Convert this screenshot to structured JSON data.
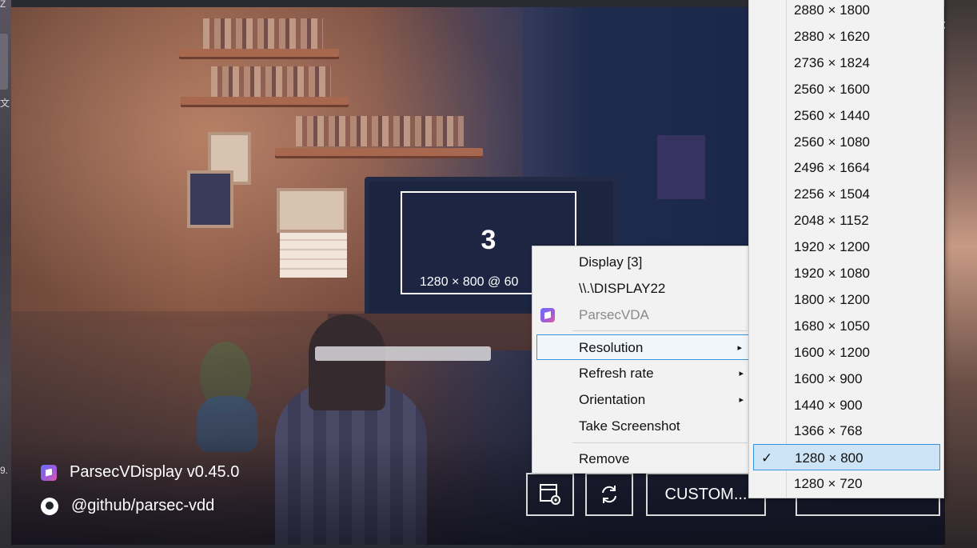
{
  "app": {
    "brand": "ParsecVDisplay v0.45.0",
    "github": "@github/parsec-vdd",
    "close_glyph": "×"
  },
  "display": {
    "number": "3",
    "resolution_label": "1280 × 800 @ 60"
  },
  "buttons": {
    "custom_label": "CUSTOM...",
    "settings_icon": "window-settings-icon",
    "refresh_icon": "refresh-icon"
  },
  "context_menu": {
    "display_label": "Display [3]",
    "device_path": "\\\\.\\DISPLAY22",
    "adapter": "ParsecVDA",
    "resolution": "Resolution",
    "refresh_rate": "Refresh rate",
    "orientation": "Orientation",
    "screenshot": "Take Screenshot",
    "remove": "Remove",
    "submenu_arrow": "▸"
  },
  "resolutions": [
    "2880 × 1800",
    "2880 × 1620",
    "2736 × 1824",
    "2560 × 1600",
    "2560 × 1440",
    "2560 × 1080",
    "2496 × 1664",
    "2256 × 1504",
    "2048 × 1152",
    "1920 × 1200",
    "1920 × 1080",
    "1800 × 1200",
    "1680 × 1050",
    "1600 × 1200",
    "1600 × 900",
    "1440 × 900",
    "1366 × 768",
    "1280 × 800",
    "1280 × 720"
  ],
  "selected_resolution": "1280 × 800",
  "check_glyph": "✓",
  "desktop": {
    "left_glyph_top": "Z",
    "left_glyph_mid": "文",
    "left_glyph_bottom": "9."
  }
}
